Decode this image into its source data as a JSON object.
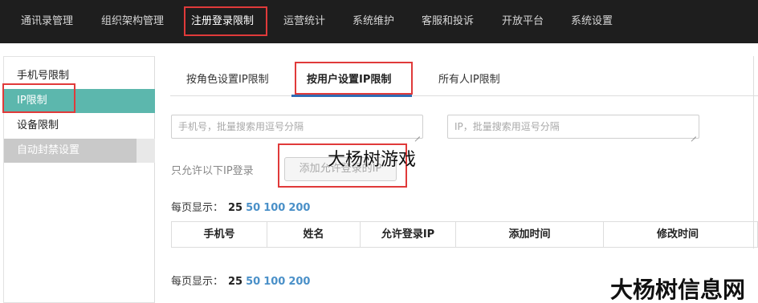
{
  "nav": {
    "items": [
      {
        "label": "通讯录管理"
      },
      {
        "label": "组织架构管理"
      },
      {
        "label": "注册登录限制"
      },
      {
        "label": "运营统计"
      },
      {
        "label": "系统维护"
      },
      {
        "label": "客服和投诉"
      },
      {
        "label": "开放平台"
      },
      {
        "label": "系统设置"
      }
    ],
    "active_index": 2
  },
  "sidebar": {
    "items": [
      {
        "label": "手机号限制"
      },
      {
        "label": "IP限制"
      },
      {
        "label": "设备限制"
      }
    ],
    "group_label": "自动封禁设置",
    "active_index": 1
  },
  "tabs": [
    {
      "label": "按角色设置IP限制"
    },
    {
      "label": "按用户设置IP限制"
    },
    {
      "label": "所有人IP限制"
    }
  ],
  "active_tab": 1,
  "search": {
    "phone_placeholder": "手机号，批量搜索用逗号分隔",
    "ip_placeholder": "IP，批量搜索用逗号分隔"
  },
  "allow": {
    "label": "只允许以下IP登录",
    "button": "添加允许登录的IP"
  },
  "pager": {
    "label": "每页显示：",
    "current": "25",
    "options": [
      "50",
      "100",
      "200"
    ]
  },
  "table": {
    "columns": [
      "手机号",
      "姓名",
      "允许登录IP",
      "添加时间",
      "修改时间"
    ]
  },
  "watermarks": {
    "center": "大杨树游戏",
    "corner": "大杨树信息网"
  },
  "colors": {
    "nav_bg": "#1e1e1e",
    "accent_teal": "#5cb7ad",
    "highlight_red": "#e03a3a",
    "tab_underline": "#2f6cb4",
    "link_blue": "#4a90c8"
  }
}
